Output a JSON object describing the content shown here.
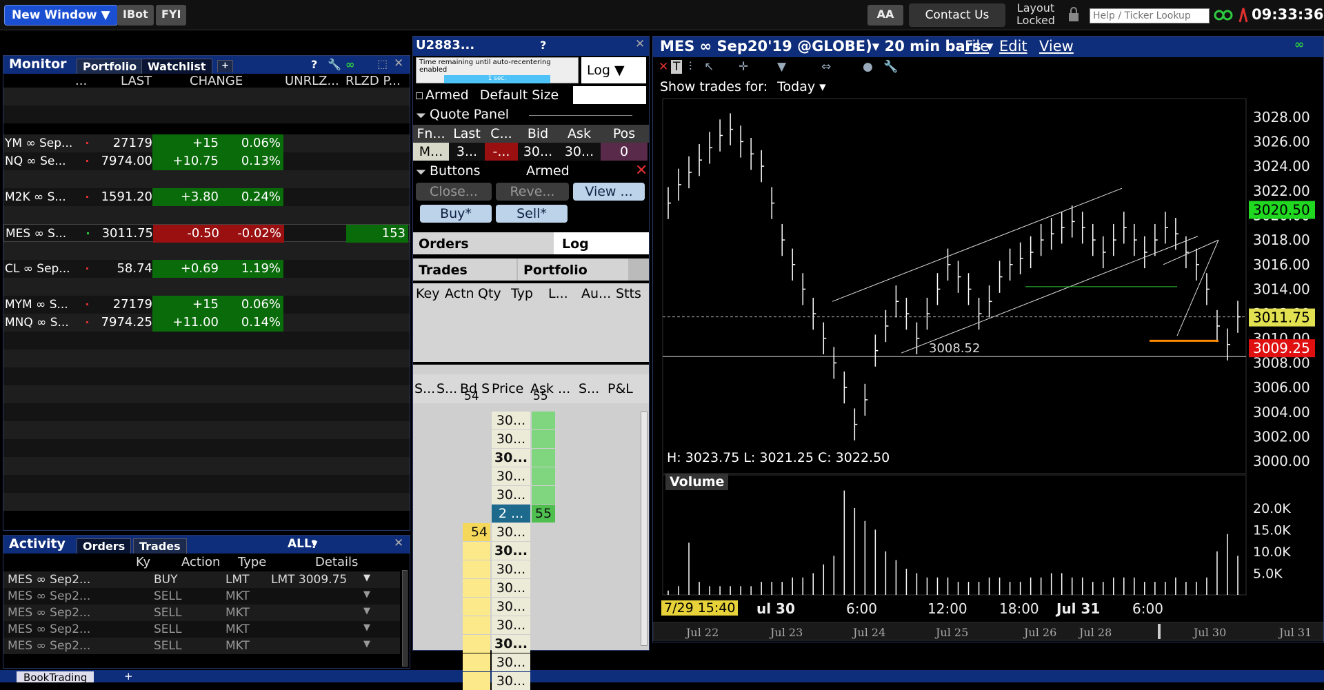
{
  "topbar": {
    "new_window": "New Window ▼",
    "ibot": "IBot",
    "fyi": "FYI",
    "aa": "AA",
    "contact": "Contact Us",
    "layout_line1": "Layout",
    "layout_line2": "Locked",
    "help_placeholder": "Help / Ticker Lookup",
    "clock": "09:33:36"
  },
  "monitor": {
    "title": "Monitor",
    "tabs": [
      "Portfolio",
      "Watchlist",
      "+"
    ],
    "headers": [
      "...",
      "LAST",
      "CHANGE",
      "UNRLZ...",
      "RLZD P..."
    ],
    "rows": [
      {
        "sym": "YM ∞ Sep...",
        "last": "27179",
        "chg": "+15",
        "pct": "0.06%",
        "dir": "up",
        "rlzd": ""
      },
      {
        "sym": "NQ ∞ Se...",
        "last": "7974.00",
        "chg": "+10.75",
        "pct": "0.13%",
        "dir": "up",
        "rlzd": ""
      },
      {
        "sym": "M2K ∞ S...",
        "last": "1591.20",
        "chg": "+3.80",
        "pct": "0.24%",
        "dir": "up",
        "rlzd": ""
      },
      {
        "sym": "MES ∞ S...",
        "last": "3011.75",
        "chg": "-0.50",
        "pct": "-0.02%",
        "dir": "down",
        "rlzd": "153"
      },
      {
        "sym": "CL ∞ Sep...",
        "last": "58.74",
        "chg": "+0.69",
        "pct": "1.19%",
        "dir": "up",
        "rlzd": ""
      },
      {
        "sym": "MYM ∞ S...",
        "last": "27179",
        "chg": "+15",
        "pct": "0.06%",
        "dir": "up",
        "rlzd": ""
      },
      {
        "sym": "MNQ ∞ S...",
        "last": "7974.25",
        "chg": "+11.00",
        "pct": "0.14%",
        "dir": "up",
        "rlzd": ""
      }
    ]
  },
  "activity": {
    "title": "Activity",
    "tabs": [
      "Orders",
      "Trades"
    ],
    "filter": "ALL▾",
    "headers": [
      "Ky",
      "Action",
      "Type",
      "Details"
    ],
    "rows": [
      {
        "sym": "MES ∞ Sep2...",
        "action": "BUY",
        "type": "LMT",
        "details": "LMT 3009.75"
      },
      {
        "sym": "MES ∞ Sep2...",
        "action": "SELL",
        "type": "MKT",
        "details": ""
      },
      {
        "sym": "MES ∞ Sep2...",
        "action": "SELL",
        "type": "MKT",
        "details": ""
      },
      {
        "sym": "MES ∞ Sep2...",
        "action": "SELL",
        "type": "MKT",
        "details": ""
      },
      {
        "sym": "MES ∞ Sep2...",
        "action": "SELL",
        "type": "MKT",
        "details": ""
      }
    ]
  },
  "bottom_tab": "BookTrading",
  "trader": {
    "title": "U2883...",
    "recenter": "Time remaining until auto-recentering enabled",
    "recenter_time": "1 sec.",
    "log_select": "Log ▼",
    "armed_label": "Armed",
    "default_size": "Default Size",
    "quote_panel": "Quote Panel",
    "quote_headers": [
      "Fn...",
      "Last",
      "C...",
      "Bid",
      "Ask",
      "Pos"
    ],
    "quote_values": [
      "M...",
      "3...",
      "-...",
      "30...",
      "30...",
      "0"
    ],
    "buttons_label": "Buttons",
    "armed2": "Armed",
    "close_btn": "Close...",
    "reverse_btn": "Reve...",
    "view_btn": "View ...",
    "buy_btn": "Buy*",
    "sell_btn": "Sell*",
    "tabs_row1": [
      "Orders",
      "Log"
    ],
    "tabs_row2": [
      "Trades",
      "Portfolio"
    ],
    "order_headers": [
      "Key",
      "Actn",
      "Qty",
      "Typ",
      "L...",
      "Au...",
      "Stts"
    ],
    "ladder_headers": [
      "S...",
      "S...",
      "Bd S",
      "Price",
      "Ask",
      "...",
      "S...",
      "P&L"
    ],
    "ladder_bid_size": "54",
    "ladder_ask_size": "55",
    "ladder_rows": [
      {
        "bid": "",
        "price": "30...",
        "ask": "",
        "bold": false
      },
      {
        "bid": "",
        "price": "30...",
        "ask": "",
        "bold": false
      },
      {
        "bid": "",
        "price": "30...",
        "ask": "",
        "bold": true
      },
      {
        "bid": "",
        "price": "30...",
        "ask": "",
        "bold": false
      },
      {
        "bid": "",
        "price": "30...",
        "ask": "",
        "bold": false
      },
      {
        "bid": "",
        "price": "2 ...",
        "ask": "55",
        "bold": false
      },
      {
        "bid": "54",
        "price": "30...",
        "ask": "",
        "bold": false
      },
      {
        "bid": "",
        "price": "30...",
        "ask": "",
        "bold": true
      },
      {
        "bid": "",
        "price": "30...",
        "ask": "",
        "bold": false
      },
      {
        "bid": "",
        "price": "30...",
        "ask": "",
        "bold": false
      },
      {
        "bid": "",
        "price": "30...",
        "ask": "",
        "bold": false
      },
      {
        "bid": "",
        "price": "30...",
        "ask": "",
        "bold": false
      },
      {
        "bid": "",
        "price": "30...",
        "ask": "",
        "bold": true
      },
      {
        "bid": "",
        "price": "30...",
        "ask": "",
        "bold": false
      },
      {
        "bid": "",
        "price": "30...",
        "ask": "",
        "bold": false
      }
    ]
  },
  "chart": {
    "title": "MES ∞ Sep20'19 @GLOBE)▾ 20 min bars ▾",
    "menu": [
      "File",
      "Edit",
      "View"
    ],
    "show_trades": "Show trades for:",
    "show_trades_value": "Today ▾",
    "hlc": "H: 3023.75 L: 3021.25 C: 3022.50",
    "volume_label": "Volume",
    "line_label": "3008.52",
    "time_cursor": "7/29 15:40"
  },
  "chart_data": {
    "type": "line",
    "price_ticks": [
      "3028.00",
      "3026.00",
      "3024.00",
      "3022.00",
      "3020.00",
      "3018.00",
      "3016.00",
      "3014.00",
      "3012.00",
      "3010.00",
      "3008.00",
      "3006.00",
      "3004.00",
      "3002.00",
      "3000.00"
    ],
    "ylim": [
      3000,
      3029
    ],
    "price_tags": [
      {
        "value": "3020.50",
        "color": "#20d820",
        "y": 3020.5
      },
      {
        "value": "3011.75",
        "color": "#e0e050",
        "y": 3011.75
      },
      {
        "value": "3009.25",
        "color": "#e01010",
        "y": 3009.25
      }
    ],
    "volume_ticks": [
      "20.0K",
      "15.0K",
      "10.0K",
      "5.0K"
    ],
    "time_labels": [
      "ul 30",
      "6:00",
      "12:00",
      "18:00",
      "Jul 31",
      "6:00"
    ],
    "nav_labels": [
      "Jul 22",
      "Jul 23",
      "Jul 24",
      "Jul 25",
      "Jul 26",
      "Jul 28",
      "Jul 30",
      "Jul 31"
    ],
    "closes": [
      3021,
      3022.5,
      3023.5,
      3024.5,
      3025.5,
      3026.5,
      3027,
      3026,
      3025,
      3024,
      3021,
      3018,
      3016,
      3014,
      3012,
      3010,
      3008,
      3006,
      3003,
      3005,
      3009,
      3011,
      3013,
      3012,
      3010,
      3012,
      3014,
      3016,
      3015,
      3014,
      3012,
      3013,
      3015,
      3016,
      3016.5,
      3017,
      3018,
      3018.5,
      3019,
      3019.5,
      3019,
      3018,
      3017,
      3018,
      3019,
      3018,
      3017,
      3018,
      3019,
      3018.5,
      3017,
      3016,
      3014,
      3011,
      3009.5,
      3011.75
    ],
    "volumes": [
      1,
      2,
      12,
      3,
      2,
      2,
      2,
      2,
      2,
      3,
      3,
      3,
      4,
      4,
      5,
      7,
      9,
      24,
      20,
      17,
      15,
      10,
      8,
      6,
      5,
      4,
      4,
      4,
      3,
      3,
      3,
      4,
      4,
      3,
      3,
      4,
      4,
      5,
      5,
      4,
      4,
      3,
      3,
      4,
      4,
      4,
      3,
      3,
      3,
      4,
      3,
      3,
      4,
      10,
      14,
      9
    ]
  }
}
